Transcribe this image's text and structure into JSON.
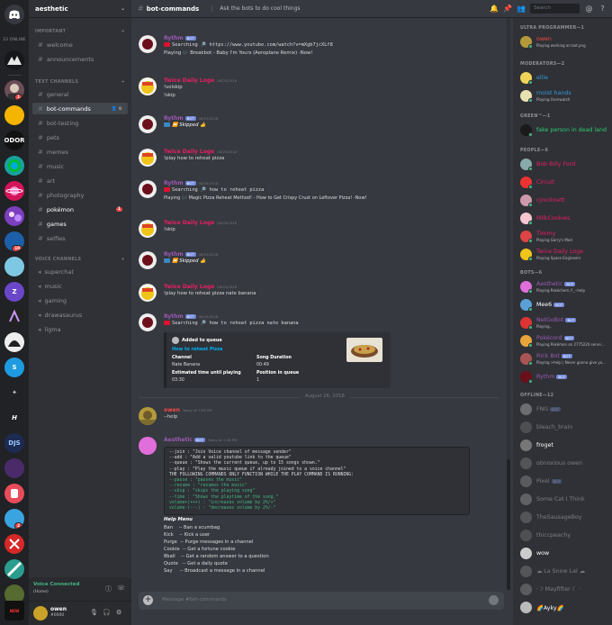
{
  "server": {
    "name": "aesthetic",
    "online_label": "33 ONLINE",
    "badges": [
      "1",
      "10",
      "2"
    ]
  },
  "channels": {
    "cat_important": "IMPORTANT",
    "cat_text": "TEXT CHANNELS",
    "cat_voice": "VOICE CHANNELS",
    "important": [
      {
        "name": "welcome"
      },
      {
        "name": "announcements"
      }
    ],
    "text": [
      {
        "name": "general"
      },
      {
        "name": "bot-commands"
      },
      {
        "name": "bot-testing"
      },
      {
        "name": "pets"
      },
      {
        "name": "memes"
      },
      {
        "name": "music"
      },
      {
        "name": "art"
      },
      {
        "name": "photography"
      },
      {
        "name": "pokémon",
        "count": "1"
      },
      {
        "name": "games"
      },
      {
        "name": "selfies"
      }
    ],
    "voice": [
      {
        "name": "superchat"
      },
      {
        "name": "music"
      },
      {
        "name": "gaming"
      },
      {
        "name": "drawasaurus"
      },
      {
        "name": "ligma"
      }
    ]
  },
  "voice_panel": {
    "status": "Voice Connected",
    "sub": "(Home)"
  },
  "user_panel": {
    "name": "owen",
    "tag": "#0000"
  },
  "topbar": {
    "channel": "bot-commands",
    "topic": "Ask the bots to do cool things",
    "search_placeholder": "Search"
  },
  "messages": {
    "m1": {
      "user": "Rythm",
      "bot": "BOT",
      "l1": "Searching 🔎 https://www.youtube.com/watch?v=mXgb7jcXLf8",
      "l2": "Playing 🎶 Breakbot - Baby I'm Yours (Aeroplane Remix) -Now!"
    },
    "m2": {
      "user": "Twice Daily Loge",
      "ts": "08/25/2018",
      "l1": "!volskip",
      "l2": "!skip"
    },
    "m3": {
      "user": "Rythm",
      "bot": "BOT",
      "ts": "08/25/2018",
      "l1": "⏩ Skipped 👍"
    },
    "m4": {
      "user": "Twice Daily Loge",
      "ts": "08/25/2018",
      "l1": "!play how to reheat pizza"
    },
    "m5": {
      "user": "Rythm",
      "bot": "BOT",
      "ts": "08/25/2018",
      "l1": "Searching 🔎 how to reheat pizza",
      "l2": "Playing 🎶 Magic Pizza Reheat Method! - How to Get Crispy Crust on Leftover Pizza! -Now!"
    },
    "m6": {
      "user": "Twice Daily Loge",
      "ts": "08/25/2018",
      "l1": "!skip"
    },
    "m7": {
      "user": "Rythm",
      "bot": "BOT",
      "ts": "08/25/2018",
      "l1": "⏩ Skipped 👍"
    },
    "m8": {
      "user": "Twice Daily Loge",
      "ts": "08/25/2018",
      "l1": "!play how to reheat pizza nate banana"
    },
    "m9": {
      "user": "Rythm",
      "bot": "BOT",
      "ts": "08/25/2018",
      "l1": "Searching 🔎 how to reheat pizza nate banana"
    },
    "embed": {
      "added": "Added to queue",
      "title": "How to reheat Pizza",
      "channel_h": "Channel",
      "channel_v": "Nate Banana",
      "duration_h": "Song Duration",
      "duration_v": "00:49",
      "est_h": "Estimated time until playing",
      "est_v": "03:30",
      "pos_h": "Position in queue",
      "pos_v": "1"
    },
    "date_divider": "August 26, 2018",
    "m10": {
      "user": "owen",
      "ts": "Today at 7:09 PM",
      "l1": "--help"
    },
    "m11": {
      "user": "Aesthetic",
      "bot": "BOT",
      "ts": "Today at 7:09 PM",
      "code": [
        "--join : \"Join Voice channel of message sender\"",
        "--add : \"Add a valid youtube link to the queue\"",
        "--queue : \"Shows the current queue, up to 15 songs shown.\"",
        "--play : \"Play the music queue if already joined to a voice channel\"",
        "",
        "THE FOLLOWING COMMANDS ONLY FUNCTION WHILE THE PLAY COMMAND IS RUNNING:",
        "--pause : \"pauses the music\"",
        "--resume : \"resumes the music\"",
        "--skip : \"skips the playing song\"",
        "--time : \"Shows the playtime of the song.\"",
        "volume+(+++) : \"increases volume by 2%/+\"",
        "volume-(---) : \"decreases volume by 2%/-\""
      ],
      "help_title": "Help Menu",
      "help": [
        "Ban    -- Ban a scumbag",
        "Kick    -- Kick a user",
        "Purge  -- Purge messages in a channel",
        "Cookie  -- Get a fortune cookie",
        "8ball    -- Get a random answer to a question",
        "Quote   -- Get a daily quote",
        "Say     -- Broadcast a message in a channel"
      ]
    }
  },
  "input": {
    "placeholder": "Message #bot-commands"
  },
  "members": {
    "cat_ultra": "ULTRA PROGRAMMER—1",
    "cat_mods": "MODERATORS—2",
    "cat_green": "GREEN™—1",
    "cat_people": "PEOPLE—6",
    "cat_bots": "BOTS—6",
    "cat_offline": "OFFLINE—12",
    "ultra": [
      {
        "name": "owen",
        "game": "Playing working on bot.png",
        "color": "#f04747"
      }
    ],
    "mods": [
      {
        "name": "ellie",
        "game": "",
        "color": "#3498db"
      },
      {
        "name": "moist hands",
        "game": "Playing Overwatch",
        "color": "#3498db"
      }
    ],
    "green": [
      {
        "name": "fake person in dead land",
        "game": "",
        "color": "#2ecc71"
      }
    ],
    "people": [
      {
        "name": "Bob Billy Ford",
        "game": "",
        "color": "#e91e63"
      },
      {
        "name": "Circuit",
        "game": "",
        "color": "#e91e63"
      },
      {
        "name": "cjrocknett",
        "game": "",
        "color": "#e91e63"
      },
      {
        "name": "MilkCookies",
        "game": "",
        "color": "#e91e63"
      },
      {
        "name": "Timmy",
        "game": "Playing Garry's Mod",
        "color": "#e91e63"
      },
      {
        "name": "Twice Daily Loge",
        "game": "Playing Space Engineers",
        "color": "#e91e63"
      }
    ],
    "bots": [
      {
        "name": "Aesthetic",
        "bot": "BOT",
        "game": "Playing Pokéchem /!_--help",
        "color": "#9b59b6"
      },
      {
        "name": "Mee6",
        "bot": "BOT",
        "game": "",
        "color": "#fff"
      },
      {
        "name": "NetGoBot",
        "bot": "BOT",
        "game": "Playing..",
        "color": "#9b59b6"
      },
      {
        "name": "Pokécord",
        "bot": "BOT",
        "game": "Playing Pokémon on 2775220 serve...",
        "color": "#9b59b6"
      },
      {
        "name": "Rick Bot",
        "bot": "BOT",
        "game": "Playing >help | Never gonna give yo...",
        "color": "#9b59b6"
      },
      {
        "name": "Rythm",
        "bot": "BOT",
        "game": "",
        "color": "#9b59b6"
      }
    ],
    "offline": [
      {
        "name": "FNG",
        "bot": "BOT"
      },
      {
        "name": "bleach_brain"
      },
      {
        "name": "froget"
      },
      {
        "name": "obnoxious owen"
      },
      {
        "name": "Pixel",
        "bot": "BOT"
      },
      {
        "name": "Some Cat I Think"
      },
      {
        "name": "TheSausageBoy"
      },
      {
        "name": "thiccpeachy"
      },
      {
        "name": "wow"
      },
      {
        "name": "☁ La Snow Lal ☁"
      },
      {
        "name": "·☽ Mayfifter ☾ ·"
      },
      {
        "name": "🌈Ayky🌈"
      }
    ]
  },
  "colors": {
    "bg": "#36393f",
    "sidebar": "#2f3136",
    "guilds": "#202225",
    "blurple": "#7289da"
  }
}
